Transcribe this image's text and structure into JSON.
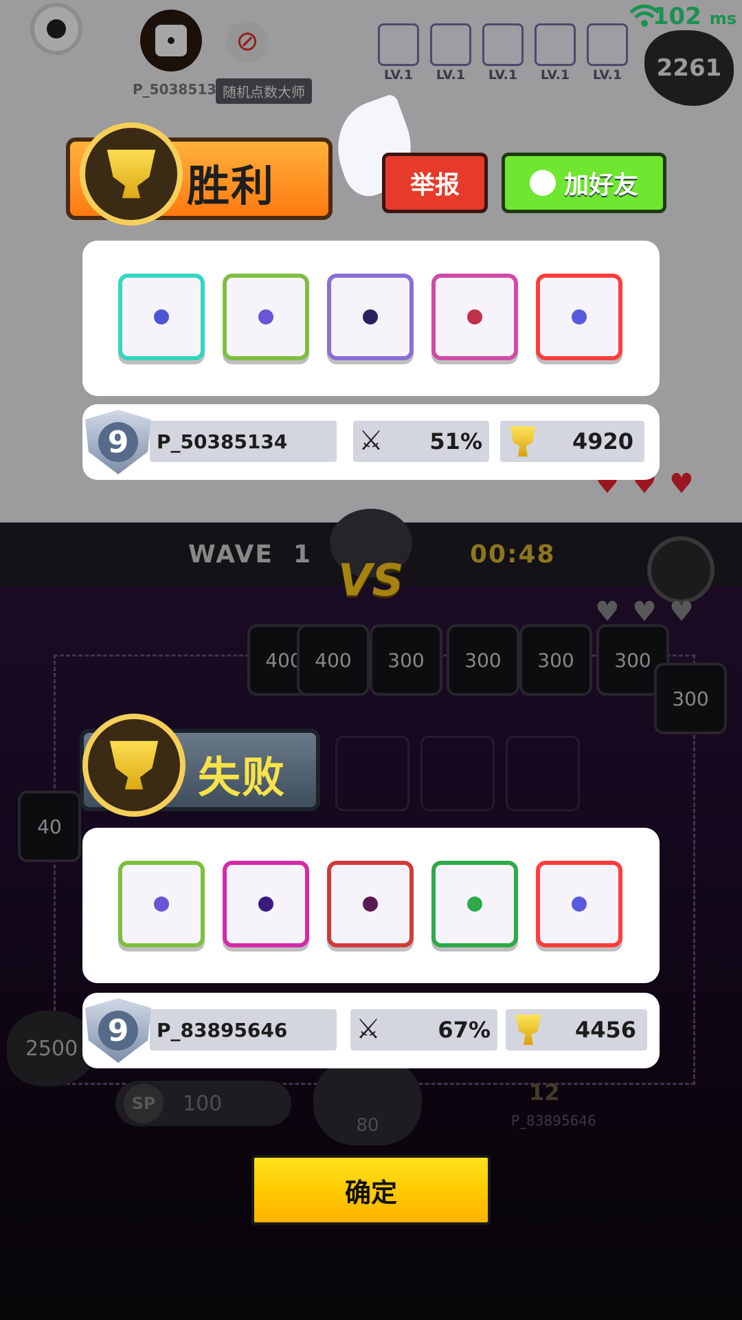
{
  "hud": {
    "ping_value": "102",
    "ping_unit": "ms",
    "top_score": "2261",
    "top_player_name": "P_50385134",
    "top_player_title": "随机点数大师",
    "top_rank": "9",
    "lv_labels": [
      "LV.1",
      "LV.1",
      "LV.1",
      "LV.1",
      "LV.1"
    ]
  },
  "match": {
    "wave_label": "WAVE",
    "wave_number": "1",
    "timer": "00:48",
    "vs": "VS"
  },
  "board": {
    "slot_values": [
      "400",
      "400",
      "300",
      "300",
      "300",
      "300",
      "300"
    ],
    "left_partial": "40",
    "bottom_score": "2500",
    "sp_label": "SP",
    "sp_value": "100",
    "spawn_cost": "80",
    "opponent_name_faint": "P_83895646",
    "opponent_score_faint": "12"
  },
  "winner": {
    "result_label": "胜利",
    "report_button": "举报",
    "add_friend_button": "加好友",
    "player_name": "P_50385134",
    "rank": "9",
    "win_rate": "51%",
    "trophies": "4920",
    "dice": [
      {
        "name": "healing-dice",
        "color": "#34d6c0",
        "pip": "#4b55d6"
      },
      {
        "name": "infinity-dice",
        "color": "#7fbf3f",
        "pip": "#6a55d6"
      },
      {
        "name": "thunder-dice",
        "color": "#8a6fd6",
        "pip": "#2a2260"
      },
      {
        "name": "sword-dice",
        "color": "#d04aa8",
        "pip": "#c0304a"
      },
      {
        "name": "rainbow-dice",
        "color": "#ff3d3d",
        "pip": "#5a5ae0"
      }
    ]
  },
  "loser": {
    "result_label": "失败",
    "player_name": "P_83895646",
    "rank": "9",
    "win_rate": "67%",
    "trophies": "4456",
    "dice": [
      {
        "name": "infinity-dice",
        "color": "#7fbf3f",
        "pip": "#6a55d6"
      },
      {
        "name": "move-dice",
        "color": "#d42aa8",
        "pip": "#3a1a80"
      },
      {
        "name": "blizzard-dice",
        "color": "#d03a3a",
        "pip": "#5a1a50"
      },
      {
        "name": "poison-dice",
        "color": "#2fa94a",
        "pip": "#2fa94a"
      },
      {
        "name": "rainbow-dice",
        "color": "#ff3d3d",
        "pip": "#5a5ae0"
      }
    ]
  },
  "confirm_button": "确定"
}
